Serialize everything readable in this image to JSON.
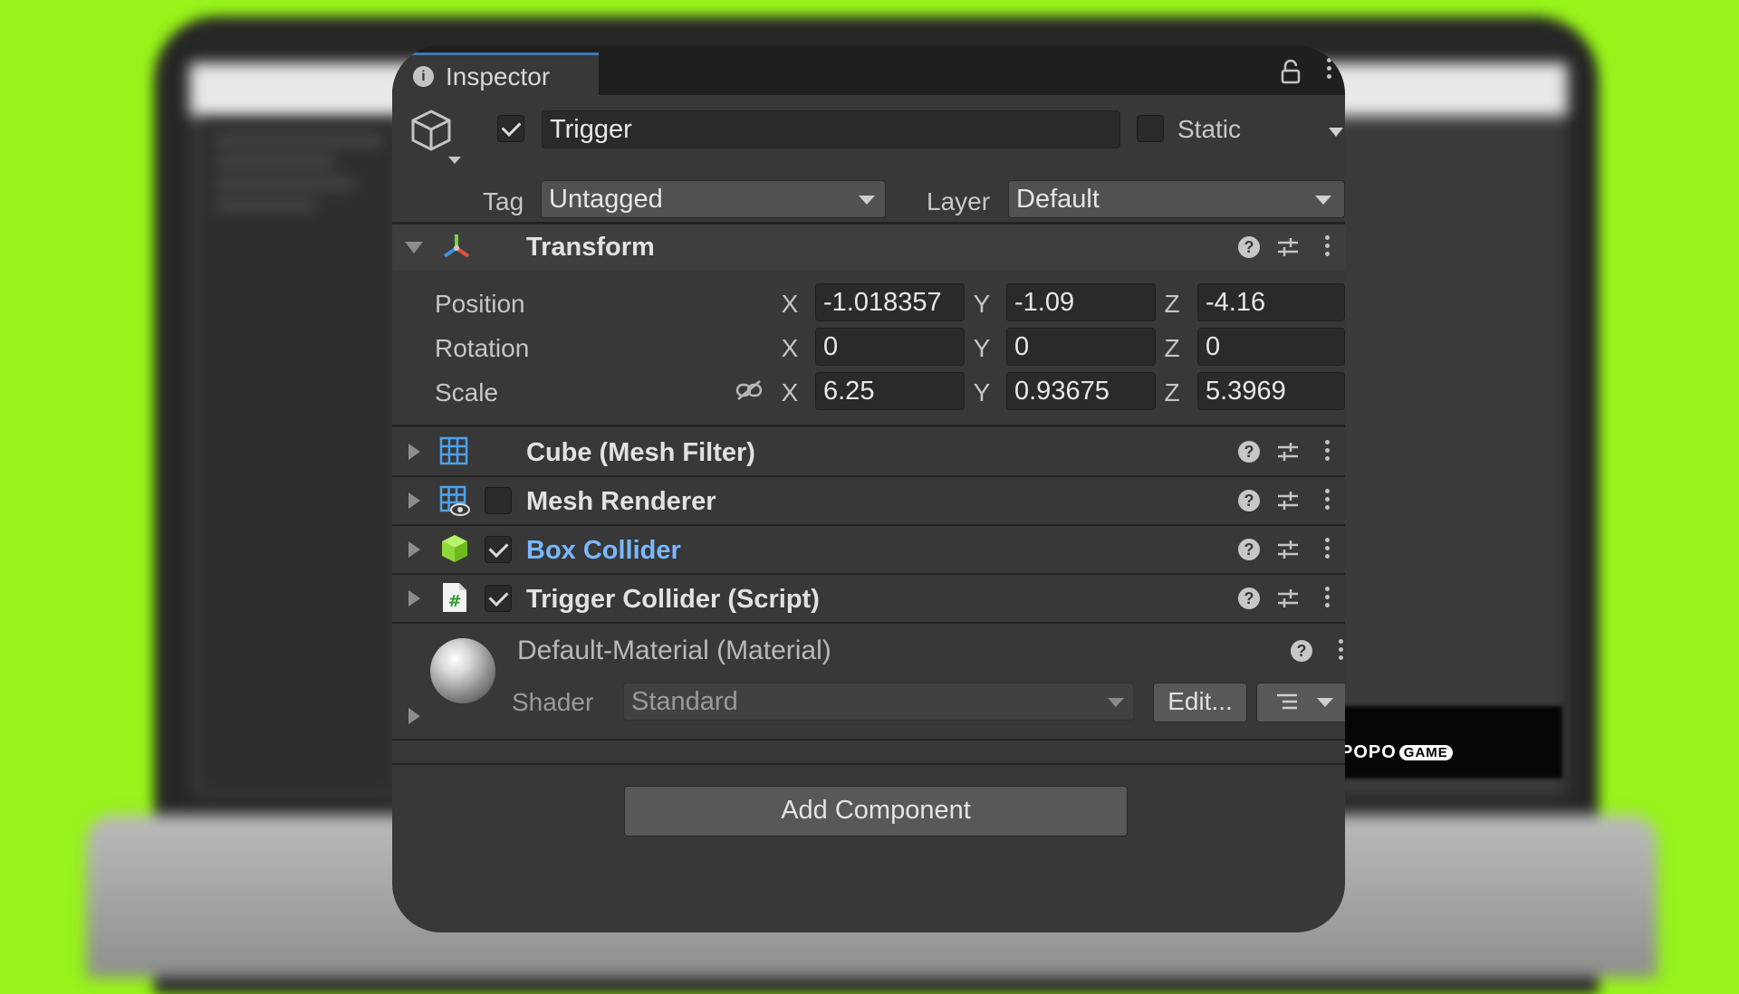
{
  "background": {
    "accent_color": "#97f31a"
  },
  "watermark": {
    "brand": "POPO",
    "brand_suffix": "GAME"
  },
  "inspector": {
    "tab_label": "Inspector",
    "game_object": {
      "name": "Trigger",
      "active": true,
      "static_label": "Static",
      "static": false,
      "tag_label": "Tag",
      "tag_value": "Untagged",
      "layer_label": "Layer",
      "layer_value": "Default"
    },
    "transform": {
      "title": "Transform",
      "expanded": true,
      "axes": {
        "x": "X",
        "y": "Y",
        "z": "Z"
      },
      "position": {
        "label": "Position",
        "x": "-1.018357",
        "y": "-1.09",
        "z": "-4.16"
      },
      "rotation": {
        "label": "Rotation",
        "x": "0",
        "y": "0",
        "z": "0"
      },
      "scale": {
        "label": "Scale",
        "x": "6.25",
        "y": "0.93675",
        "z": "5.3969"
      }
    },
    "components": [
      {
        "title": "Cube (Mesh Filter)",
        "icon": "mesh-filter-icon",
        "has_checkbox": false
      },
      {
        "title": "Mesh Renderer",
        "icon": "mesh-renderer-icon",
        "has_checkbox": true,
        "enabled": false
      },
      {
        "title": "Box Collider",
        "icon": "box-collider-icon",
        "has_checkbox": true,
        "enabled": true,
        "selected": true
      },
      {
        "title": "Trigger Collider (Script)",
        "icon": "script-icon",
        "has_checkbox": true,
        "enabled": true
      }
    ],
    "material": {
      "title": "Default-Material (Material)",
      "shader_label": "Shader",
      "shader_value": "Standard",
      "edit_label": "Edit..."
    },
    "add_component_label": "Add Component"
  }
}
